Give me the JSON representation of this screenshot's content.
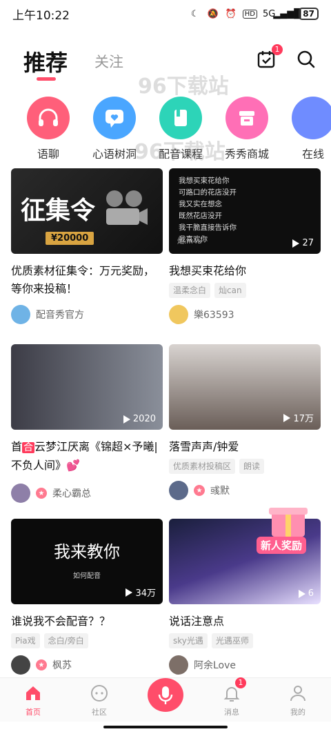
{
  "status_bar": {
    "time": "上午10:22",
    "network": "5G",
    "battery": "87",
    "hd": "HD"
  },
  "header": {
    "tabs": [
      {
        "label": "推荐",
        "active": true
      },
      {
        "label": "关注",
        "active": false
      }
    ],
    "task_badge": "1"
  },
  "categories": [
    {
      "label": "语聊",
      "icon": "headphones-icon",
      "color": "#ff5f7a"
    },
    {
      "label": "心语树洞",
      "icon": "heart-chat-icon",
      "color": "#4aa6ff"
    },
    {
      "label": "配音课程",
      "icon": "book-icon",
      "color": "#2dd4b8"
    },
    {
      "label": "秀秀商城",
      "icon": "shop-icon",
      "color": "#ff6fb6"
    },
    {
      "label": "在线",
      "icon": "online-icon",
      "color": "#6f8cff"
    }
  ],
  "cards": [
    {
      "title": "优质素材征集令：万元奖励，等你来投稿！",
      "thumb_text": "征集令",
      "thumb_sub": "¥20000",
      "play_count": "",
      "tags": [],
      "author": "配音秀官方",
      "vip": false
    },
    {
      "title": "我想买束花给你",
      "thumb_text": "我想买束花给你\n可路口的花店没开\n我又实在想念\n既然花店没开\n我干脆直接告诉你\n我喜欢你",
      "thumb_sub": "灿.m4a",
      "play_count": "27",
      "tags": [
        "温柔念白",
        "灿can"
      ],
      "author": "樂63593",
      "vip": false
    },
    {
      "title_prefix": "首",
      "title_badge": "合",
      "title": "云梦江厌离《锦超×予曦|不负人间》💕",
      "play_count": "2020",
      "tags": [],
      "author": "柔心霸总",
      "vip": true
    },
    {
      "title": "落雪声声/钟爱",
      "play_count": "17万",
      "tags": [
        "优质素材投稿区",
        "朗读"
      ],
      "author": "彧默",
      "vip": true
    },
    {
      "title": "谁说我不会配音？？",
      "thumb_text": "我来教你",
      "thumb_sub": "如何配音",
      "play_count": "34万",
      "tags": [
        "Pia戏",
        "念白/旁白"
      ],
      "author": "枫苏",
      "vip": true
    },
    {
      "title": "说话注意点",
      "thumb_badge": "新人奖励",
      "play_count": "6",
      "tags": [
        "sky光遇",
        "光遇巫师"
      ],
      "author": "阿余Love",
      "vip": false
    }
  ],
  "bottom_nav": [
    {
      "label": "首页",
      "icon": "home-icon",
      "active": true
    },
    {
      "label": "社区",
      "icon": "community-icon",
      "active": false
    },
    {
      "label": "",
      "icon": "mic-icon",
      "active": false
    },
    {
      "label": "消息",
      "icon": "bell-icon",
      "active": false,
      "badge": "1"
    },
    {
      "label": "我的",
      "icon": "profile-icon",
      "active": false
    }
  ],
  "colors": {
    "accent": "#ff4d6a",
    "badge": "#ff3b5c"
  }
}
